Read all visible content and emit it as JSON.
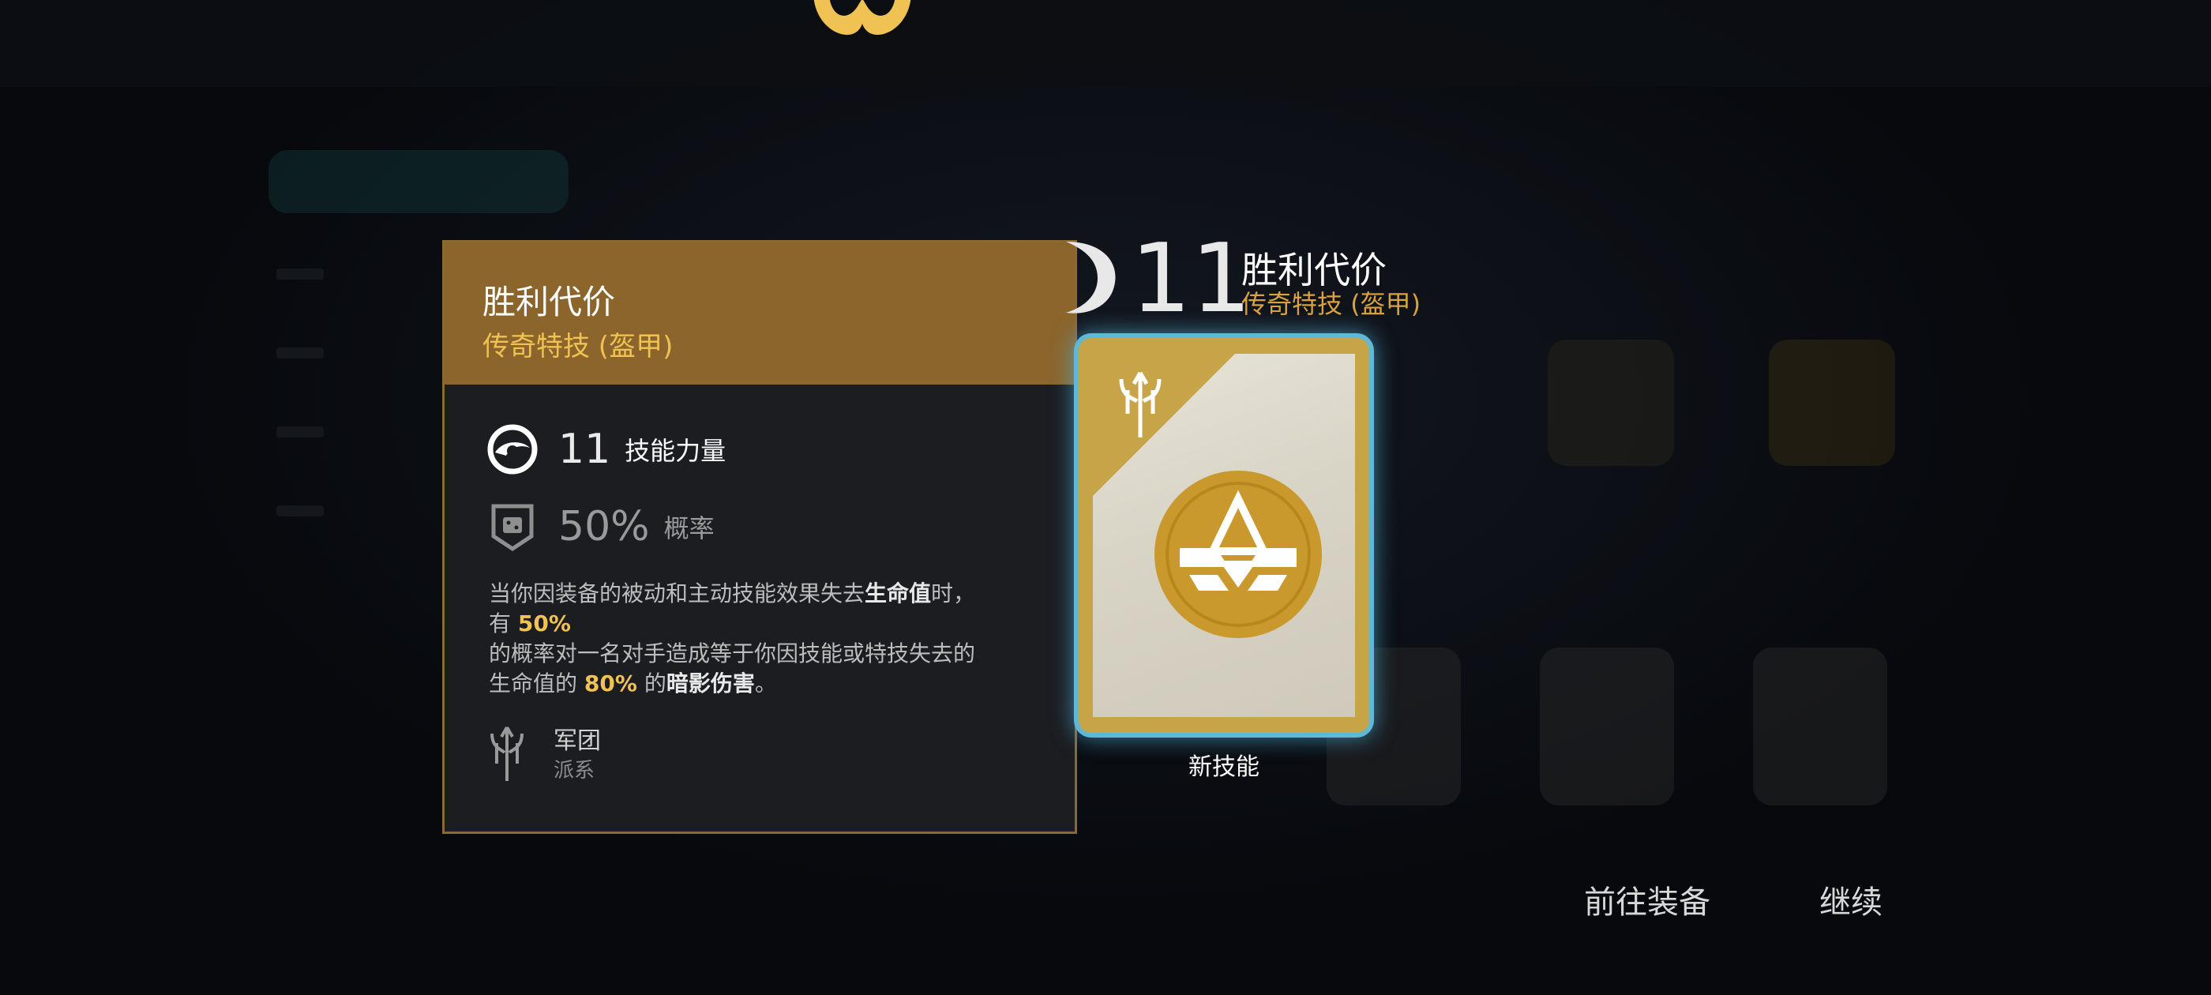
{
  "tooltip": {
    "title": "胜利代价",
    "subtitle": "传奇特技 (盔甲)",
    "stats": [
      {
        "icon": "skill-power-icon",
        "value": "11",
        "label": "技能力量"
      },
      {
        "icon": "chance-shield-icon",
        "value": "50%",
        "label": "概率"
      }
    ],
    "description": {
      "p1": "当你因装备的被动和主动技能效果失去",
      "b1": "生命值",
      "p2": "时，",
      "p3": "有",
      "hl1": "50%",
      "p4": "的概率对一名对手造成等于你因技能或特技失去的",
      "p5": "生命值的",
      "hl2": "80%",
      "p6": "的",
      "b2": "暗影伤害",
      "p7": "。"
    },
    "faction": {
      "icon": "legion-icon",
      "name": "军团",
      "type": "派系"
    }
  },
  "card_header": {
    "level": "11",
    "name": "胜利代价",
    "subtitle": "传奇特技 (盔甲)"
  },
  "card": {
    "caption": "新技能",
    "emblem": "armor-emblem-icon",
    "corner_symbol": "legion-sword-icon"
  },
  "actions": {
    "equip": "前往装备",
    "continue": "继续"
  },
  "colors": {
    "gold": "#f0c253",
    "header_bg": "#8c652c",
    "panel_bg": "#1b1d21",
    "card_glow": "#5fb8d6"
  }
}
